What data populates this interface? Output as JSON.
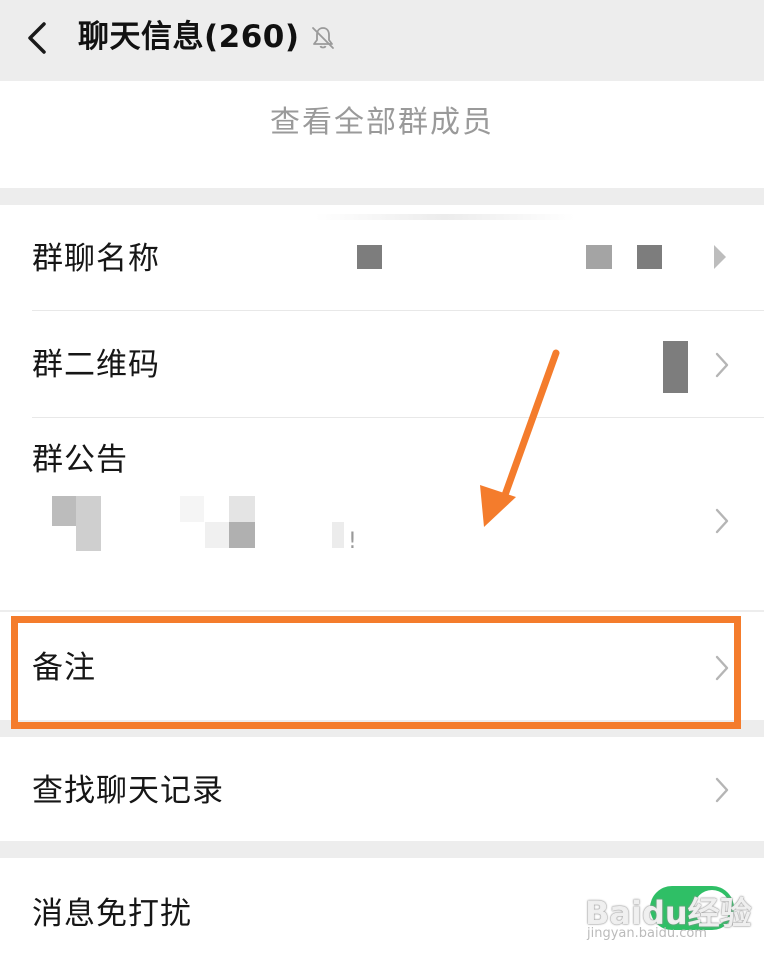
{
  "header": {
    "back_icon": "chevron-left-icon",
    "title": "聊天信息(260)",
    "mute_icon": "bell-off-icon"
  },
  "members": {
    "link_label": "查看全部群成员"
  },
  "rows": {
    "group_name": {
      "label": "群聊名称"
    },
    "qr_code": {
      "label": "群二维码"
    },
    "announcement": {
      "label": "群公告",
      "text_fragment": "!"
    },
    "remark": {
      "label": "备注"
    },
    "search_history": {
      "label": "查找聊天记录"
    },
    "do_not_disturb": {
      "label": "消息免打扰",
      "enabled": true
    }
  },
  "annotation": {
    "color": "#f47c2c",
    "icon": "arrow-icon"
  },
  "watermark": {
    "logo": "Baidu经验",
    "url": "jingyan.baidu.com"
  },
  "colors": {
    "background": "#ededed",
    "card": "#ffffff",
    "toggle_on": "#2fbf66",
    "muted_text": "#9a9a9a"
  }
}
